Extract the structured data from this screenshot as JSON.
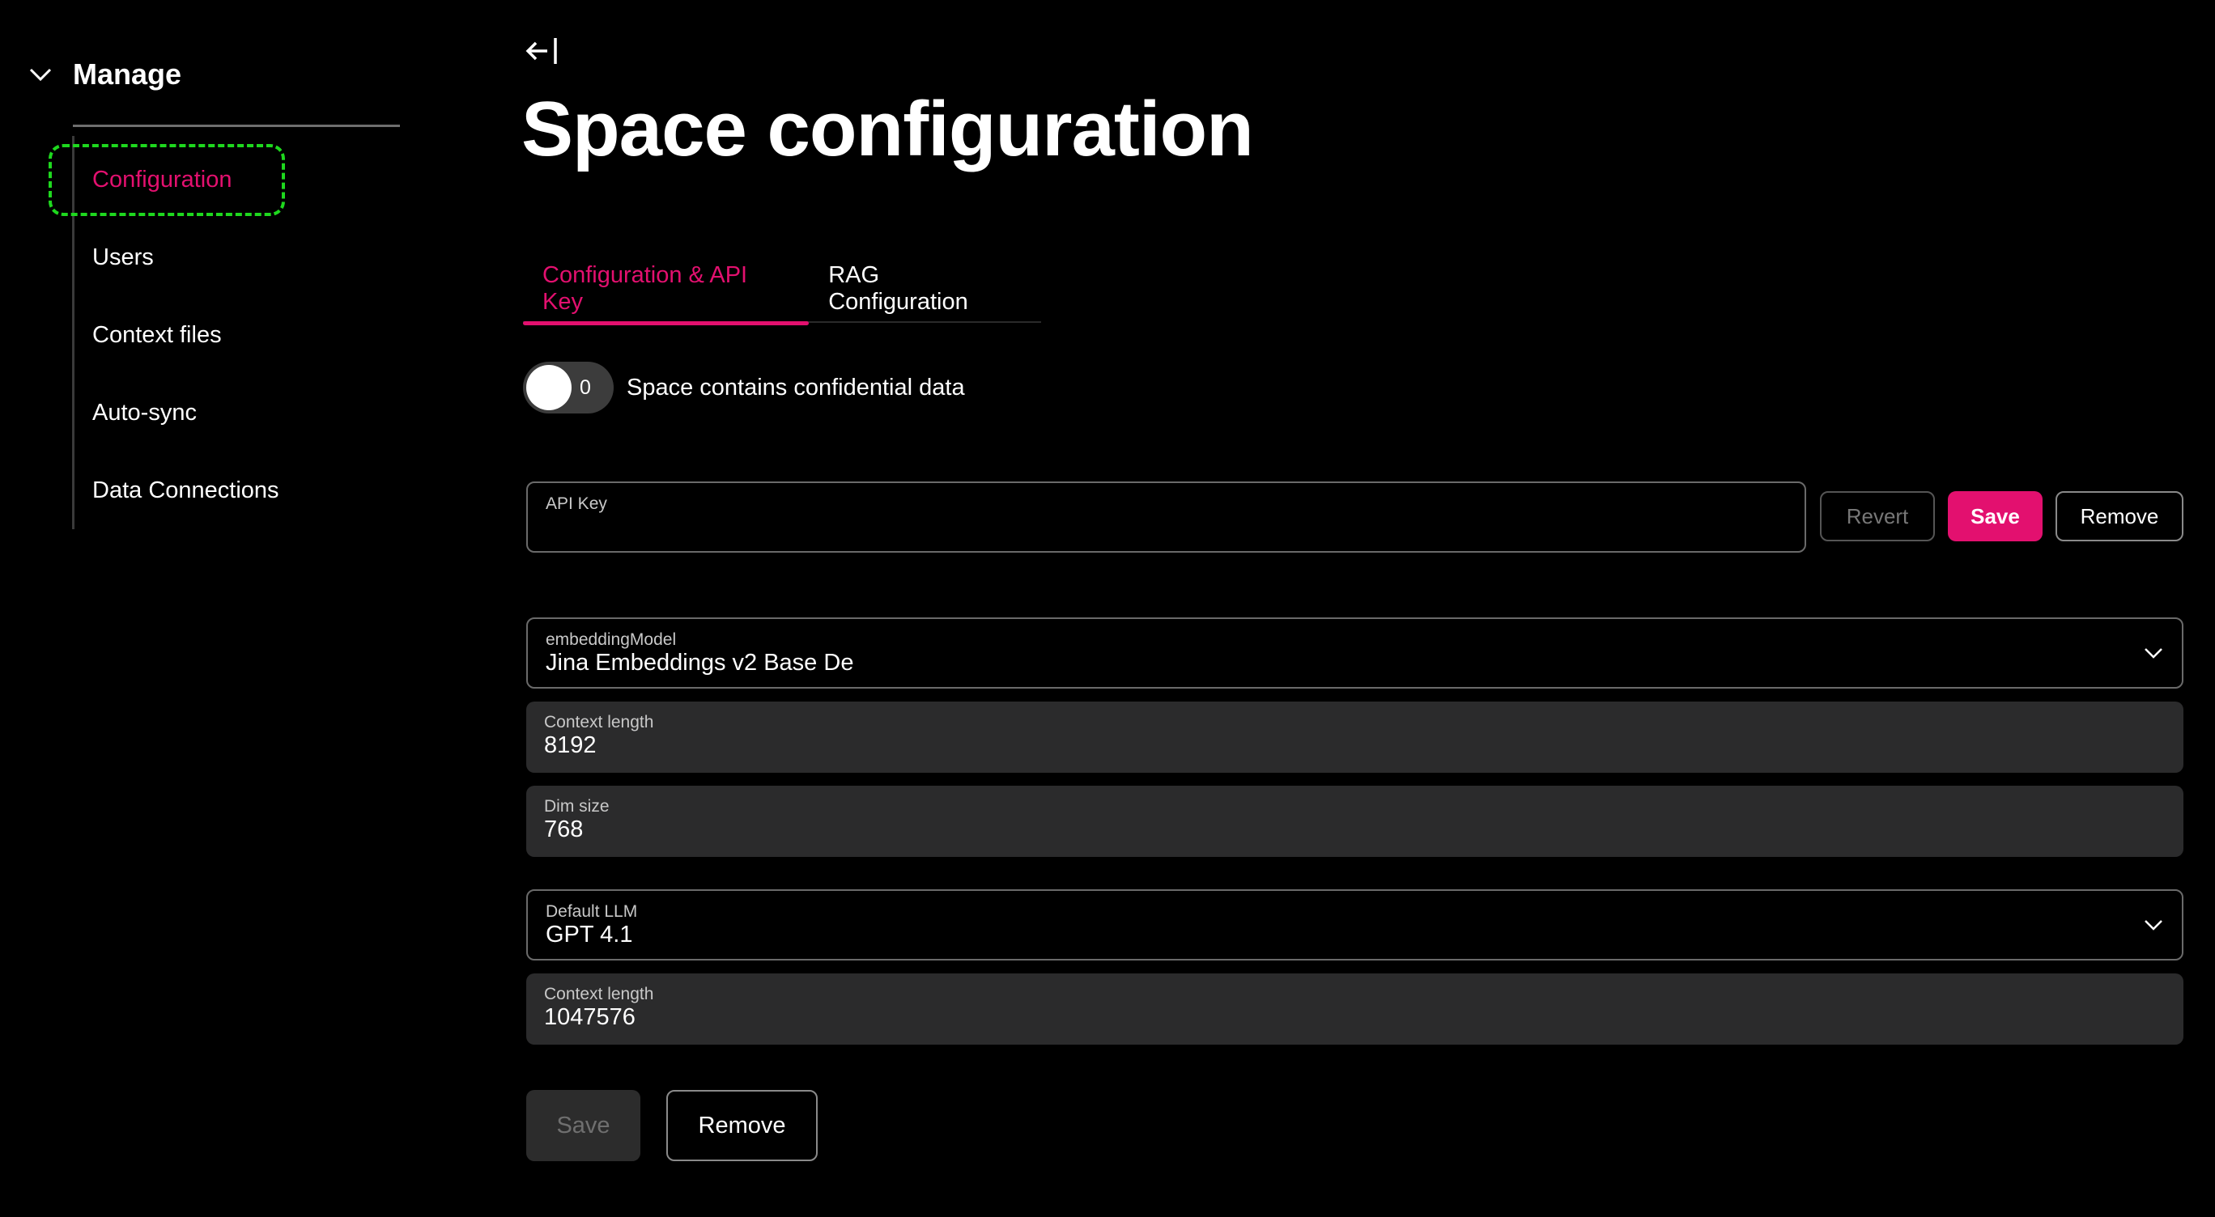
{
  "sidebar": {
    "section_title": "Manage",
    "items": [
      {
        "label": "Configuration",
        "active": true
      },
      {
        "label": "Users"
      },
      {
        "label": "Context files"
      },
      {
        "label": "Auto-sync"
      },
      {
        "label": "Data Connections"
      }
    ]
  },
  "main": {
    "title": "Space configuration",
    "tabs": [
      {
        "label": "Configuration & API Key",
        "active": true
      },
      {
        "label": "RAG Configuration"
      }
    ],
    "confidential_toggle": {
      "value": "0",
      "label": "Space contains confidential data"
    },
    "api_key": {
      "label": "API Key",
      "value": "",
      "revert_label": "Revert",
      "save_label": "Save",
      "remove_label": "Remove"
    },
    "embedding_model": {
      "label": "embeddingModel",
      "value": "Jina Embeddings v2 Base De"
    },
    "embedding_context_length": {
      "label": "Context length",
      "value": "8192"
    },
    "dim_size": {
      "label": "Dim size",
      "value": "768"
    },
    "default_llm": {
      "label": "Default LLM",
      "value": "GPT 4.1"
    },
    "llm_context_length": {
      "label": "Context length",
      "value": "1047576"
    },
    "footer": {
      "save_label": "Save",
      "remove_label": "Remove"
    }
  },
  "colors": {
    "accent": "#e3106f",
    "background": "#000000",
    "filled_field": "#2b2b2c",
    "focus_ring": "#1ed81e"
  }
}
